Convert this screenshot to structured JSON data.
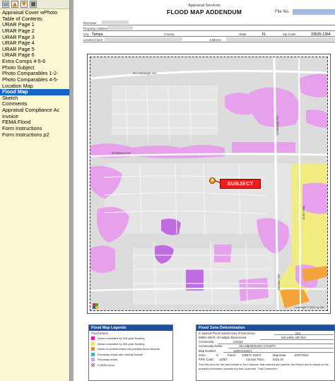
{
  "toolbar": {
    "buttons": [
      {
        "name": "open-folder",
        "glyph": "▤"
      },
      {
        "name": "move-up",
        "glyph": "▲"
      },
      {
        "name": "move-down",
        "glyph": "▼"
      },
      {
        "name": "delete",
        "glyph": "■"
      }
    ]
  },
  "sidebar": {
    "items": [
      "Appraisal Cover wPhoto",
      "Table of Contents",
      "URAR Page 1",
      "URAR Page 2",
      "URAR Page 3",
      "URAR Page 4",
      "URAR Page 5",
      "URAR Page 6",
      "Extra Comps 4-5-6",
      "Photo Subject",
      "Photo Comparables 1-2-",
      "Photo Comparables 4-5-",
      "Location Map",
      "Flood Map",
      "Sketch",
      "Comments",
      "Appraisal Compliance Ac",
      "Invoice",
      "FEMA Flood",
      "Form Instructions",
      "Form Instructions p2"
    ],
    "active_index": 13
  },
  "doc": {
    "header_sub": "Appraisal Services",
    "title": "FLOOD MAP ADDENDUM",
    "file_no_label": "File No."
  },
  "info": {
    "borrower_label": "Borrower",
    "property_label": "Property Address",
    "city_label": "City",
    "city": "Tampa",
    "county_label": "County",
    "state_label": "State",
    "state": "FL",
    "zip_label": "Zip Code",
    "zip": "33635-1364",
    "lender_label": "Lender/Client",
    "address_label": "Address"
  },
  "map": {
    "subject_label": "SUBJECT",
    "pin_label": "8",
    "streets": [
      "W Linebaugh Ave",
      "W Waters Ave",
      "Sheldon Rd",
      "Linebaugh Rd",
      "Gunn Hwy"
    ],
    "copyright": "Copyright © 2021 by IAN"
  },
  "legend": {
    "title": "Flood Map Legends",
    "subtitle": "Flood Zones",
    "items": [
      {
        "color": "#ff00c8",
        "label": "Areas inundated by 100-year flooding"
      },
      {
        "color": "#f2e64a",
        "label": "Areas inundated by 500-year flooding"
      },
      {
        "color": "#f08a1d",
        "label": "Areas of undetermined but possible flood hazards"
      },
      {
        "color": "#1cc4d8",
        "label": "Floodway areas with velocity hazard"
      },
      {
        "color": "#c9a8f0",
        "label": "Floodway areas"
      },
      {
        "color": "hatch",
        "label": "COBRA zone"
      }
    ]
  },
  "fzd": {
    "title": "Flood Zone Determination",
    "rows": [
      {
        "label": "In Special Flood Hazard Area (Flood Zone):",
        "value": "Out"
      },
      {
        "label": "Within 250 ft. of multiple flood zones:",
        "value": "Not within 250 feet"
      },
      {
        "label": "Community:",
        "value": "120112"
      },
      {
        "label": "Community Name:",
        "value": "HILLSBOROUGH COUNTY"
      },
      {
        "label": "Map Number:",
        "value": "12057C0187J"
      }
    ],
    "zone_label": "Zone:",
    "zone": "X",
    "panel_label": "Panel:",
    "panel": "12057C 0187J",
    "map_date_label": "Map Date:",
    "map_date": "10/07/2021",
    "fips_label": "FIPS Code:",
    "fips": "12057",
    "census_label": "Census Tract:",
    "census": "0115.15",
    "note": "This Report is for the sole benefit of the Customer that ordered and paid for the Report and is based on the property information provided by that Customer. That Customer's"
  }
}
